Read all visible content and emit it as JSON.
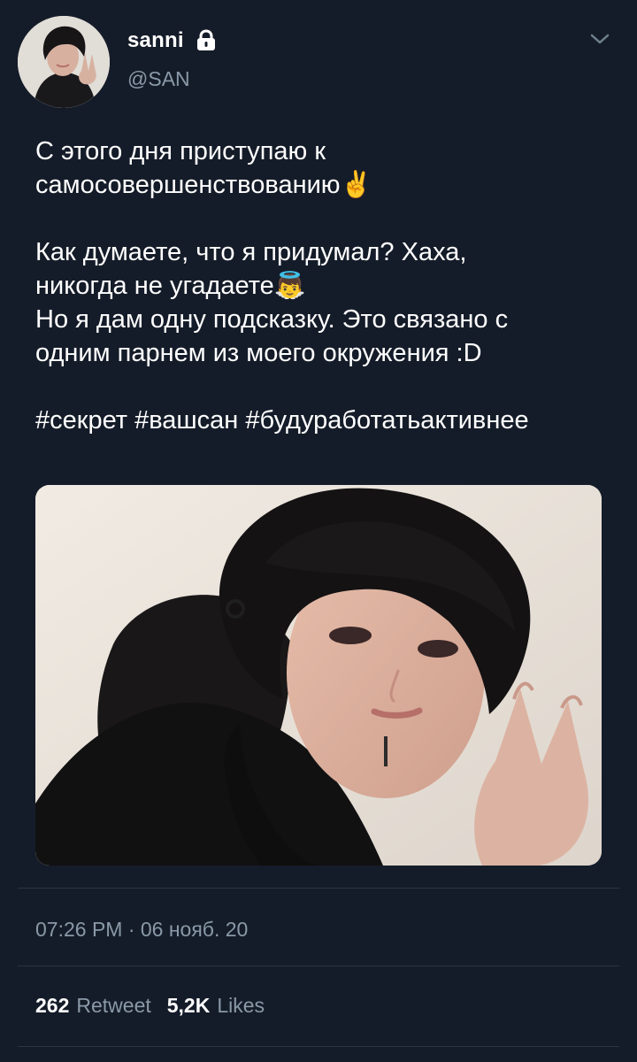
{
  "header": {
    "display_name": "sanni",
    "handle": "@SAN",
    "icons": {
      "avatar": "avatar",
      "lock": "lock-icon",
      "menu": "chevron-down-icon"
    }
  },
  "tweet": {
    "text": "С этого дня приступаю к\nсамосовершенствованию✌️\n\nКак думаете, что я придумал? Хаха,\nникогда не угадаете👼\nНо я дам одну подсказку. Это связано с\nодним парнем из моего окружения :D\n\n#секрет  #вашсан #будуработатьактивнее",
    "timestamp": "07:26 PM · 06 нояб. 20"
  },
  "stats": {
    "retweets_count": "262",
    "retweets_label": "Retweet",
    "likes_count": "5,2K",
    "likes_label": "Likes"
  },
  "colors": {
    "background": "#151c29",
    "text": "#ffffff",
    "secondary_text": "#8a99a8",
    "divider": "#2b3442"
  }
}
